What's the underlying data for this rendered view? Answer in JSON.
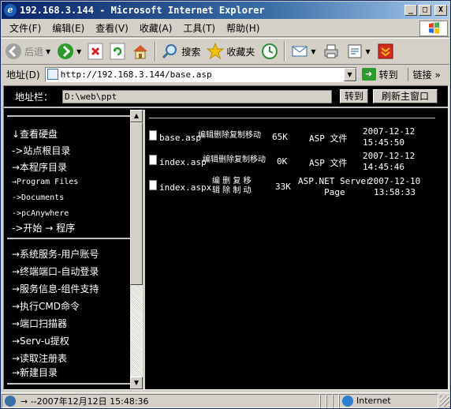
{
  "window": {
    "title": "192.168.3.144 - Microsoft Internet Explorer",
    "btn_min": "_",
    "btn_max": "□",
    "btn_close": "X"
  },
  "menu": [
    "文件(F)",
    "编辑(E)",
    "查看(V)",
    "收藏(A)",
    "工具(T)",
    "帮助(H)"
  ],
  "toolbar": {
    "back_label": "后退",
    "search_label": "搜索",
    "favorites_label": "收藏夹"
  },
  "address": {
    "label": "地址(D)",
    "url": "http://192.168.3.144/base.asp",
    "go_label": "转到",
    "links_label": "链接 »"
  },
  "page": {
    "path_label": "地址栏：",
    "path_value": "D:\\web\\ppt",
    "go_button": "转到",
    "refresh_button": "刷新主窗口"
  },
  "nav": {
    "dirs": [
      "↓查看硬盘",
      "->站点根目录",
      "→本程序目录",
      "→Program Files",
      "->Documents",
      "->pcAnywhere",
      "->开始 → 程序"
    ],
    "tools": [
      "→系统服务-用户账号",
      "→终端端口-自动登录",
      "→服务信息-组件支持",
      "→执行CMD命令",
      "→端口扫描器",
      "→Serv-u提权",
      "→读取注册表",
      "→新建目录"
    ]
  },
  "files": [
    {
      "name": "base.asp",
      "actions": "编辑删除复制移动",
      "size": "65K",
      "type": "ASP 文件",
      "date": "2007-12-12",
      "time": "15:45:50"
    },
    {
      "name": "index.asp",
      "actions": "编辑删除复制移动",
      "size": "0K",
      "type": "ASP 文件",
      "date": "2007-12-12",
      "time": "14:45:46"
    },
    {
      "name": "index.aspx",
      "actions_line1": "编 删 复 移",
      "actions_line2": "辑 除 制 动",
      "size": "33K",
      "type_line1": "ASP.NET Server",
      "type_line2": "Page",
      "date": "2007-12-10",
      "time": "13:58:33"
    }
  ],
  "status": {
    "text": "→   --2007年12月12日 15:48:36",
    "zone": "Internet"
  },
  "colors": {
    "titlebar_start": "#0a246a",
    "page_background": "#000000",
    "page_text": "#ffffff",
    "chrome": "#d4d0c8"
  }
}
